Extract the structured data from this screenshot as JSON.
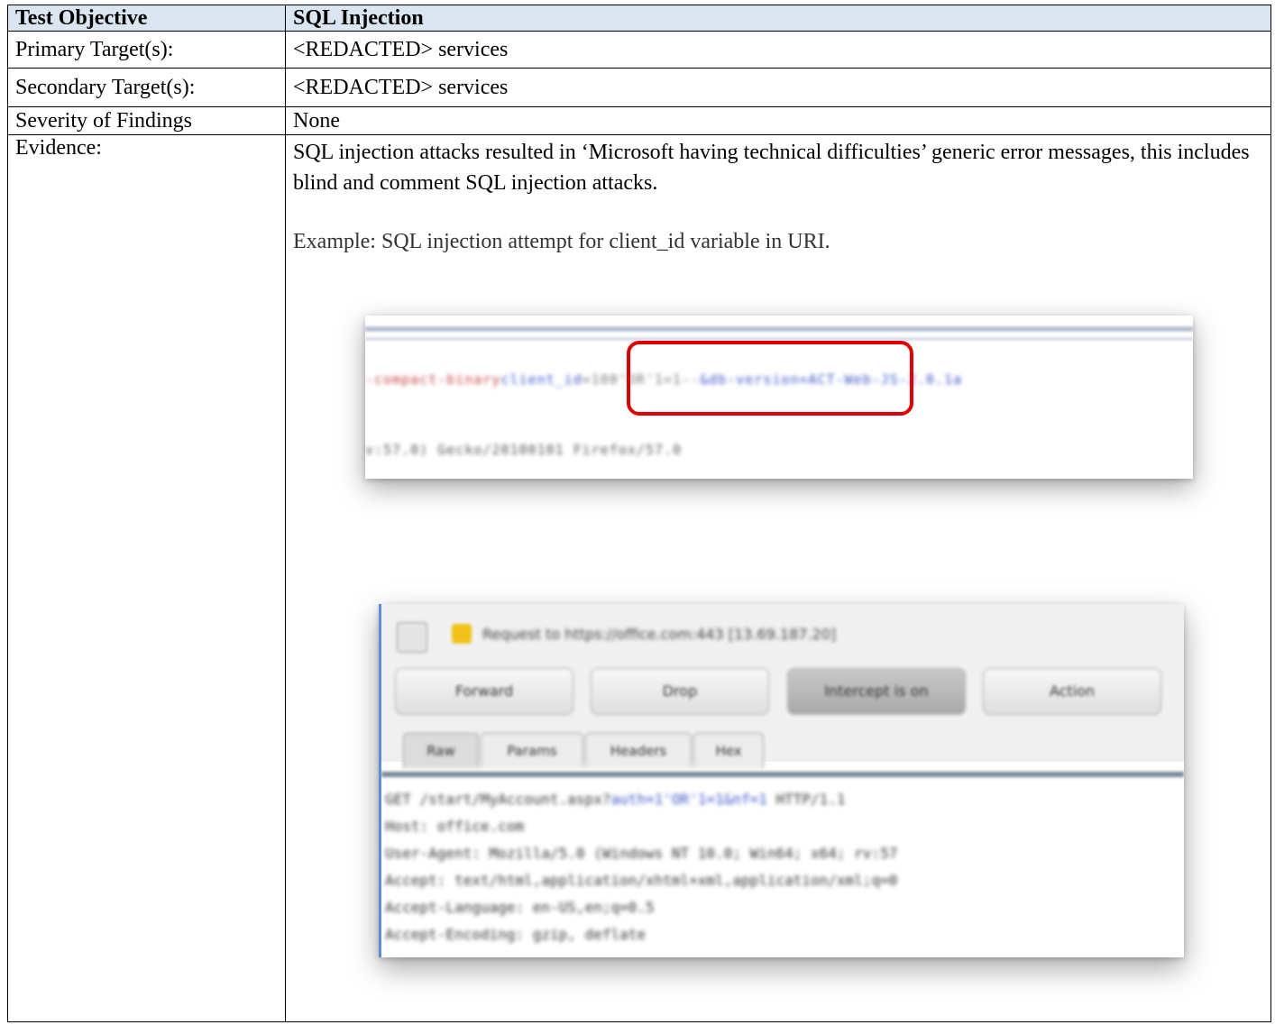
{
  "table": {
    "header": {
      "label": "Test Objective",
      "value": "SQL Injection"
    },
    "rows": [
      {
        "label": "Primary Target(s):",
        "value": "<REDACTED> services"
      },
      {
        "label": "Secondary Target(s):",
        "value": "<REDACTED> services"
      },
      {
        "label": "Severity of Findings",
        "value": "None"
      }
    ],
    "evidence": {
      "label": "Evidence:",
      "text": "SQL injection attacks resulted in ‘Microsoft having technical difficulties’ generic error messages, this includes blind and comment SQL injection attacks.",
      "example": "Example: SQL injection attempt for client_id variable in URI."
    }
  },
  "screenshot1": {
    "url_parts": {
      "red": "-compact-binary",
      "blue_param": "client_id",
      "grey_value": "=100'OR'1=1--",
      "blue_rest": "&db-version=ACT-Web-JS-2.0.1a"
    },
    "user_agent": "v:57.0) Gecko/20100101 Firefox/57.0",
    "highlight_color": "#e00000"
  },
  "screenshot2": {
    "request_text": "Request to https://office.com:443  [13.69.187.20]",
    "buttons": [
      "Forward",
      "Drop",
      "Intercept is on",
      "Action"
    ],
    "tabs": [
      "Raw",
      "Params",
      "Headers",
      "Hex"
    ],
    "request_lines": {
      "line1_prefix": "GET /start/MyAccount.aspx?",
      "line1_blue": "auth=1'OR'1=1&nf=1",
      "line1_suffix": " HTTP/1.1",
      "line2": "Host: office.com",
      "line3": "User-Agent: Mozilla/5.0 (Windows NT 10.0; Win64; x64; rv:57",
      "line4": "Accept: text/html,application/xhtml+xml,application/xml;q=0",
      "line5": "Accept-Language: en-US,en;q=0.5",
      "line6": "Accept-Encoding: gzip, deflate"
    }
  }
}
